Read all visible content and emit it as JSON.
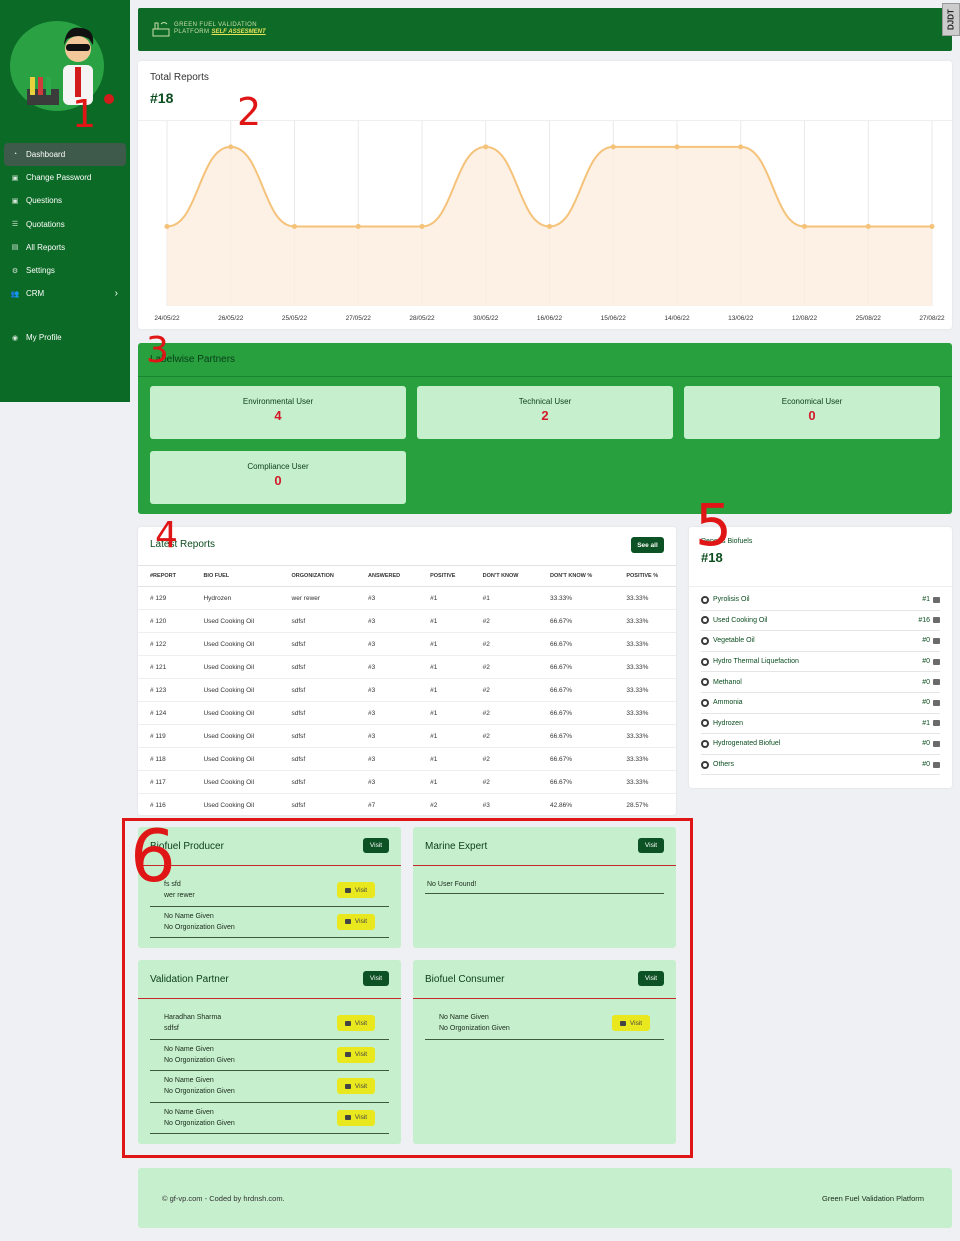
{
  "colors": {
    "sidebar": "#0b6a25",
    "accent_green": "#27a03d",
    "light_green": "#c6efcd",
    "chart_line": "#f5c27a",
    "red": "#e01616",
    "yellow_button": "#e9e81e"
  },
  "header": {
    "brand_line1": "GREEN FUEL VALIDATION",
    "brand_line2": "PLATFORM",
    "brand_sub": "SELF ASSESMENT",
    "debug_tab": "DJDT"
  },
  "sidebar": {
    "items": [
      {
        "label": "Dashboard",
        "icon": "pie-chart-icon"
      },
      {
        "label": "Change Password",
        "icon": "lock-icon"
      },
      {
        "label": "Questions",
        "icon": "question-icon"
      },
      {
        "label": "Quotations",
        "icon": "list-icon"
      },
      {
        "label": "All Reports",
        "icon": "report-icon"
      },
      {
        "label": "Settings",
        "icon": "gear-icon"
      },
      {
        "label": "CRM",
        "icon": "users-icon"
      }
    ],
    "profile": "My Profile"
  },
  "total_reports": {
    "title": "Total Reports",
    "count": "#18"
  },
  "chart_data": {
    "type": "area",
    "x": [
      "24/05/22",
      "26/05/22",
      "25/05/22",
      "27/05/22",
      "28/05/22",
      "30/05/22",
      "16/06/22",
      "15/06/22",
      "14/06/22",
      "13/06/22",
      "12/08/22",
      "25/08/22",
      "27/08/22"
    ],
    "series": [
      {
        "values": [
          1,
          2,
          1,
          1,
          1,
          2,
          1,
          2,
          2,
          2,
          1,
          1,
          1
        ]
      }
    ],
    "ylim": [
      0,
      2.2
    ],
    "grid": true
  },
  "partners": {
    "title": "Labelwise Partners",
    "boxes": [
      {
        "label": "Environmental User",
        "value": "4"
      },
      {
        "label": "Technical User",
        "value": "2"
      },
      {
        "label": "Economical User",
        "value": "0"
      },
      {
        "label": "Compliance User",
        "value": "0"
      }
    ]
  },
  "latest_reports": {
    "title": "Latest Reports",
    "see_all": "See all",
    "columns": [
      "#REPORT",
      "BIO FUEL",
      "ORGONIZATION",
      "ANSWERED",
      "POSITIVE",
      "DON'T KNOW",
      "DON'T KNOW %",
      "POSITIVE %"
    ],
    "rows": [
      [
        "# 129",
        "Hydrozen",
        "wer rewer",
        "#3",
        "#1",
        "#1",
        "33.33%",
        "33.33%"
      ],
      [
        "# 120",
        "Used Cooking Oil",
        "sdfsf",
        "#3",
        "#1",
        "#2",
        "66.67%",
        "33.33%"
      ],
      [
        "# 122",
        "Used Cooking Oil",
        "sdfsf",
        "#3",
        "#1",
        "#2",
        "66.67%",
        "33.33%"
      ],
      [
        "# 121",
        "Used Cooking Oil",
        "sdfsf",
        "#3",
        "#1",
        "#2",
        "66.67%",
        "33.33%"
      ],
      [
        "# 123",
        "Used Cooking Oil",
        "sdfsf",
        "#3",
        "#1",
        "#2",
        "66.67%",
        "33.33%"
      ],
      [
        "# 124",
        "Used Cooking Oil",
        "sdfsf",
        "#3",
        "#1",
        "#2",
        "66.67%",
        "33.33%"
      ],
      [
        "# 119",
        "Used Cooking Oil",
        "sdfsf",
        "#3",
        "#1",
        "#2",
        "66.67%",
        "33.33%"
      ],
      [
        "# 118",
        "Used Cooking Oil",
        "sdfsf",
        "#3",
        "#1",
        "#2",
        "66.67%",
        "33.33%"
      ],
      [
        "# 117",
        "Used Cooking Oil",
        "sdfsf",
        "#3",
        "#1",
        "#2",
        "66.67%",
        "33.33%"
      ],
      [
        "# 116",
        "Used Cooking Oil",
        "sdfsf",
        "#7",
        "#2",
        "#3",
        "42.86%",
        "28.57%"
      ]
    ]
  },
  "biofuels": {
    "title": "Reports Biofuels",
    "count": "#18",
    "items": [
      {
        "name": "Pyrolisis Oil",
        "count": "#1"
      },
      {
        "name": "Used Cooking Oil",
        "count": "#16"
      },
      {
        "name": "Vegetable Oil",
        "count": "#0"
      },
      {
        "name": "Hydro Thermal Liquefaction",
        "count": "#0"
      },
      {
        "name": "Methanol",
        "count": "#0"
      },
      {
        "name": "Ammonia",
        "count": "#0"
      },
      {
        "name": "Hydrozen",
        "count": "#1"
      },
      {
        "name": "Hydrogenated Biofuel",
        "count": "#0"
      },
      {
        "name": "Others",
        "count": "#0"
      }
    ]
  },
  "user_cards": {
    "visit": "Visit",
    "biofuel_producer": {
      "title": "Biofuel Producer",
      "users": [
        [
          "fs sfd",
          "wer rewer"
        ],
        [
          "No Name Given",
          "No Orgonization Given"
        ]
      ]
    },
    "marine_expert": {
      "title": "Marine Expert",
      "empty": "No User Found!"
    },
    "validation_partner": {
      "title": "Validation Partner",
      "users": [
        [
          "Haradhan Sharma",
          "sdfsf"
        ],
        [
          "No Name Given",
          "No Orgonization Given"
        ],
        [
          "No Name Given",
          "No Orgonization Given"
        ],
        [
          "No Name Given",
          "No Orgonization Given"
        ]
      ]
    },
    "biofuel_consumer": {
      "title": "Biofuel Consumer",
      "users": [
        [
          "No Name Given",
          "No Orgonization Given"
        ]
      ]
    }
  },
  "footer": {
    "left": "© gf-vp.com - Coded by hrdnsh.com.",
    "right": "Green Fuel Validation Platform"
  },
  "annotations": [
    "1",
    "2",
    "3",
    "4",
    "5",
    "6"
  ]
}
